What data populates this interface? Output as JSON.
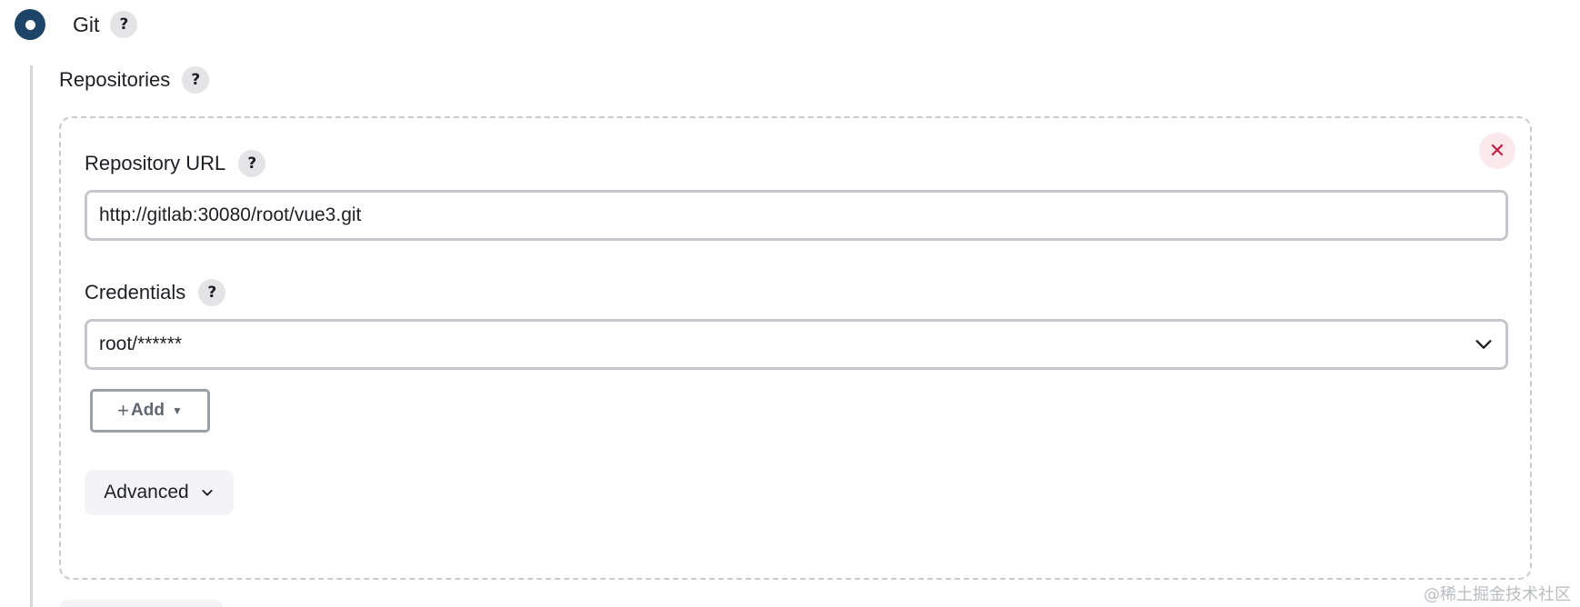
{
  "scm": {
    "label": "Git",
    "help": "?",
    "selected": true
  },
  "repositories": {
    "label": "Repositories",
    "help": "?"
  },
  "repository": {
    "close_symbol": "✕",
    "url_label": "Repository URL",
    "url_help": "?",
    "url_value": "http://gitlab:30080/root/vue3.git",
    "credentials_label": "Credentials",
    "credentials_help": "?",
    "credentials_value": "root/******",
    "add_plus": "+",
    "add_label": "Add",
    "add_caret": "▼",
    "advanced_label": "Advanced"
  },
  "watermark": "@稀土掘金技术社区",
  "colors": {
    "radio_selected": "#1e4468",
    "close_icon": "#c21d44",
    "close_bg": "#fbe8ec"
  }
}
